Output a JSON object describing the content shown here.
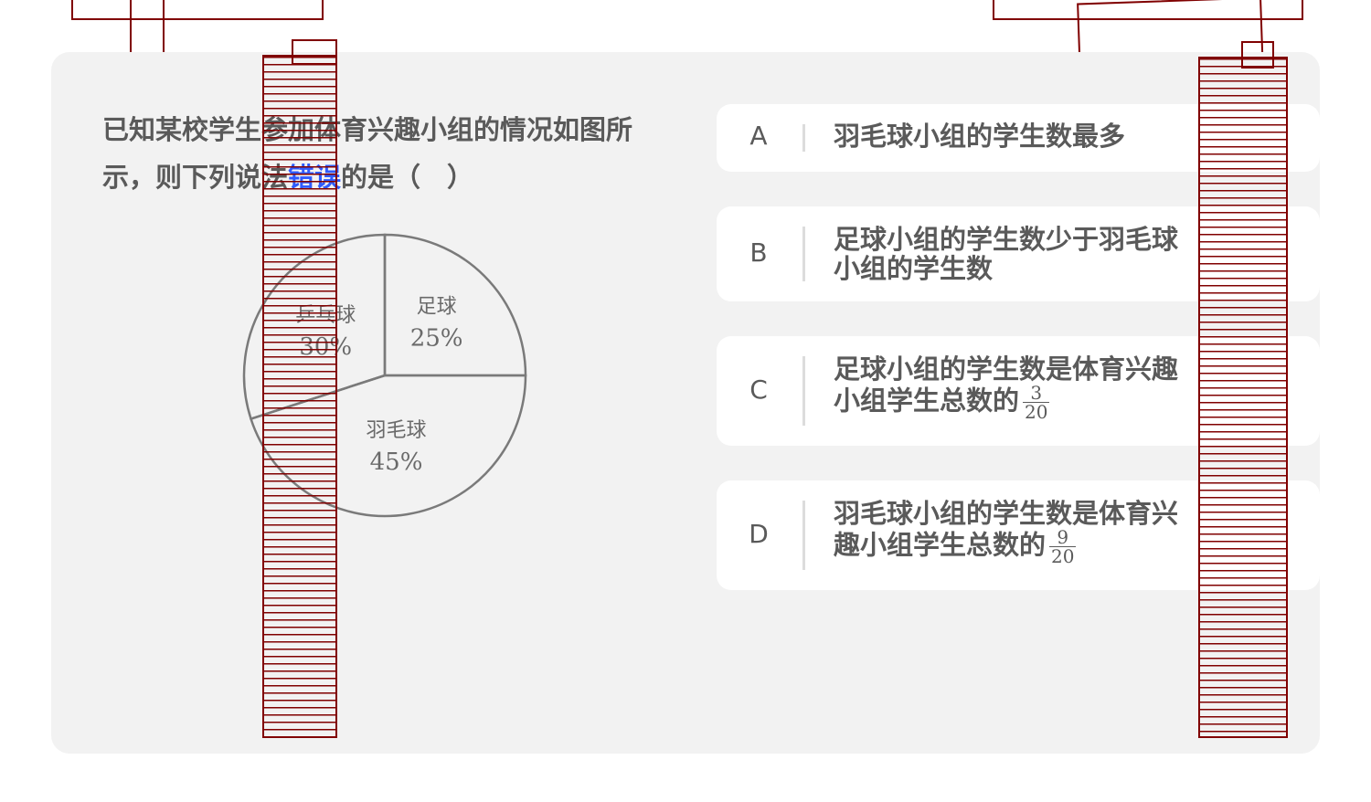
{
  "question": {
    "text_before": "已知某校学生参加体育兴趣小组的情况如图所示，则下列说法",
    "highlight": "错误",
    "text_after": "的是（　）"
  },
  "chart_data": {
    "type": "pie",
    "slices": [
      {
        "label": "足球",
        "value": 25,
        "display": "25%"
      },
      {
        "label": "羽毛球",
        "value": 45,
        "display": "45%"
      },
      {
        "label": "乒乓球",
        "value": 30,
        "display": "30%"
      }
    ]
  },
  "options": [
    {
      "letter": "A",
      "text": "羽毛球小组的学生数最多"
    },
    {
      "letter": "B",
      "text": "足球小组的学生数少于羽毛球小组的学生数"
    },
    {
      "letter": "C",
      "text": "足球小组的学生数是体育兴趣小组学生总数的",
      "frac_num": "3",
      "frac_den": "20"
    },
    {
      "letter": "D",
      "text": "羽毛球小组的学生数是体育兴趣小组学生总数的",
      "frac_num": "9",
      "frac_den": "20"
    }
  ],
  "colors": {
    "card_bg": "#f2f2f2",
    "option_bg": "#ffffff",
    "text": "#5a5a5a",
    "highlight": "#2f5bff",
    "overlay": "#800000"
  }
}
